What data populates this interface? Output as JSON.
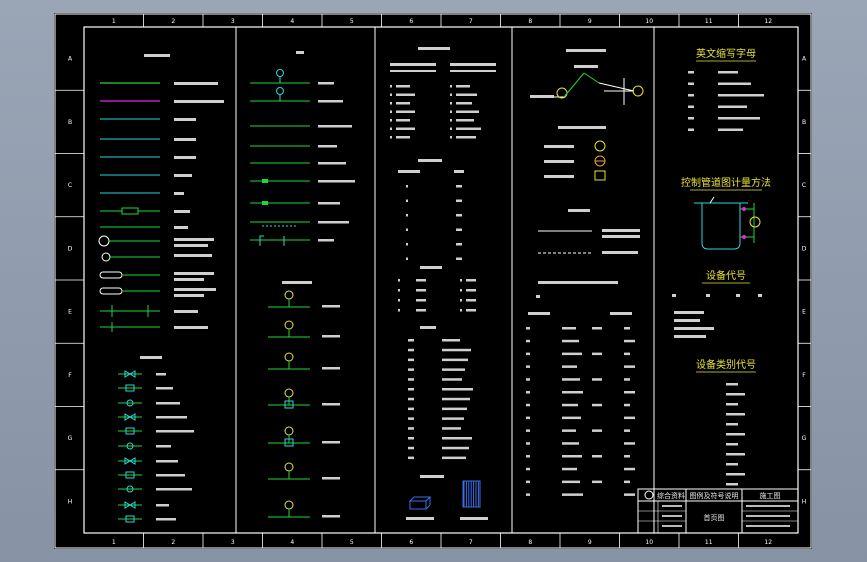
{
  "drawing": {
    "col_markers": [
      "1",
      "2",
      "3",
      "4",
      "5",
      "6",
      "7",
      "8",
      "9",
      "10",
      "11",
      "12"
    ],
    "row_markers": [
      "A",
      "B",
      "C",
      "D",
      "E",
      "F",
      "G",
      "H"
    ],
    "headings": {
      "english_codes": "英文缩写字母",
      "interlock_methods": "控制管道图计量方法",
      "equipment_codes": "设备代号",
      "equipment_category_codes": "设备类别代号"
    },
    "title_block": {
      "company": "综合资料",
      "drawing_title": "图例及符号说明",
      "stage": "施工图",
      "sheet_name": "首页图"
    }
  },
  "palette": {
    "frame": "#ffffff",
    "green": "#22d63a",
    "magenta": "#e02ae0",
    "cyan": "#2ad6e0",
    "yellow": "#e8e23a",
    "blue": "#3a6ee8",
    "orange": "#e8a23a",
    "text": "#d8d8d8"
  }
}
